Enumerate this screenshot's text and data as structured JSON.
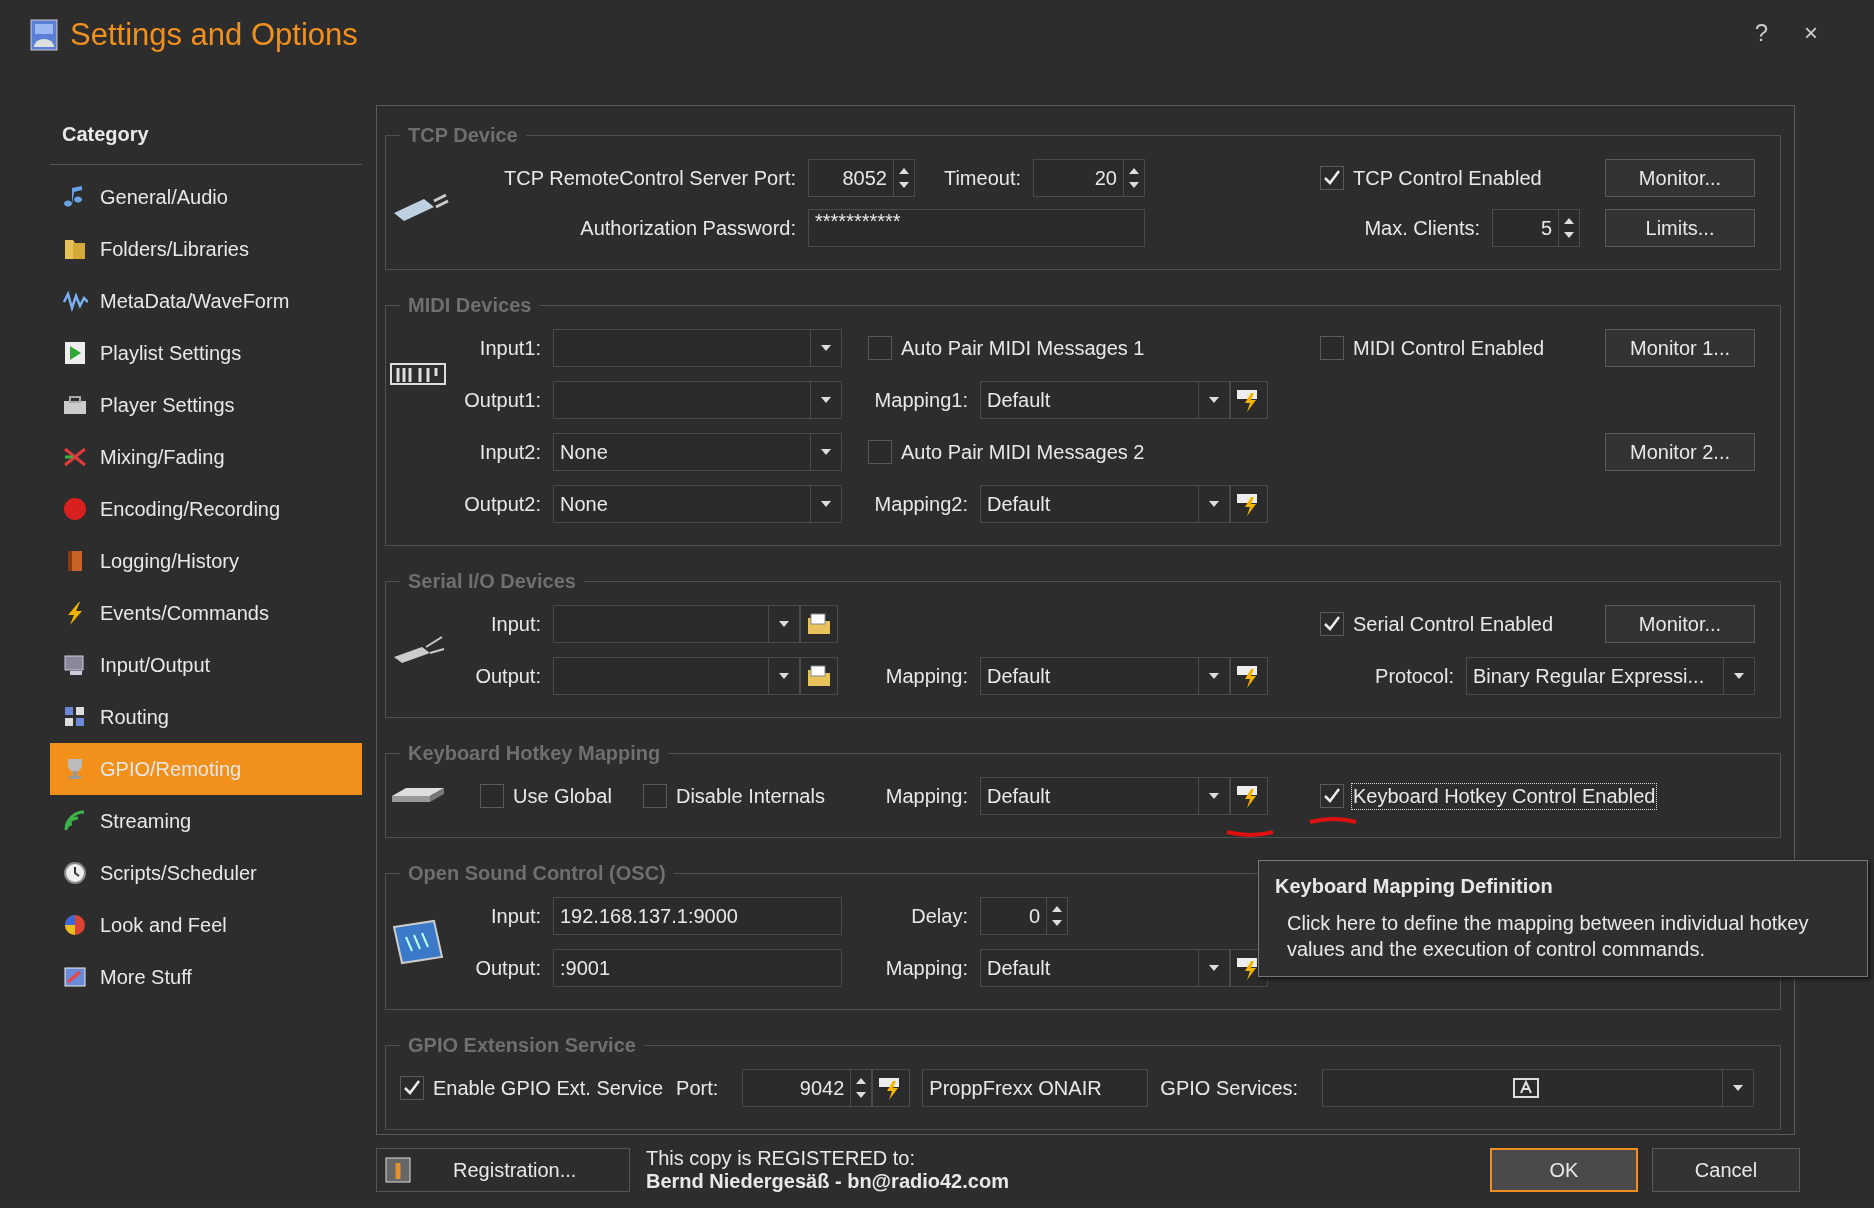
{
  "window": {
    "title": "Settings and Options",
    "help": "?",
    "close": "×"
  },
  "sidebar": {
    "heading": "Category",
    "items": [
      {
        "label": "General/Audio",
        "selected": false
      },
      {
        "label": "Folders/Libraries",
        "selected": false
      },
      {
        "label": "MetaData/WaveForm",
        "selected": false
      },
      {
        "label": "Playlist Settings",
        "selected": false
      },
      {
        "label": "Player Settings",
        "selected": false
      },
      {
        "label": "Mixing/Fading",
        "selected": false
      },
      {
        "label": "Encoding/Recording",
        "selected": false
      },
      {
        "label": "Logging/History",
        "selected": false
      },
      {
        "label": "Events/Commands",
        "selected": false
      },
      {
        "label": "Input/Output",
        "selected": false
      },
      {
        "label": "Routing",
        "selected": false
      },
      {
        "label": "GPIO/Remoting",
        "selected": true
      },
      {
        "label": "Streaming",
        "selected": false
      },
      {
        "label": "Scripts/Scheduler",
        "selected": false
      },
      {
        "label": "Look and Feel",
        "selected": false
      },
      {
        "label": "More Stuff",
        "selected": false
      }
    ]
  },
  "tcp": {
    "legend": "TCP Device",
    "port_label": "TCP RemoteControl Server Port:",
    "port": "8052",
    "timeout_label": "Timeout:",
    "timeout": "20",
    "enabled": {
      "label": "TCP Control Enabled",
      "checked": true
    },
    "monitor": "Monitor...",
    "password_label": "Authorization Password:",
    "password": "***********",
    "max_clients_label": "Max. Clients:",
    "max_clients": "5",
    "limits": "Limits..."
  },
  "midi": {
    "legend": "MIDI Devices",
    "input1": {
      "label": "Input1:"
    },
    "auto_pair1": {
      "label": "Auto Pair MIDI Messages 1",
      "checked": false
    },
    "enabled": {
      "label": "MIDI Control Enabled",
      "checked": false
    },
    "monitor1": "Monitor 1...",
    "output1": {
      "label": "Output1:"
    },
    "mapping1": {
      "label": "Mapping1:",
      "value": "Default"
    },
    "input2": {
      "label": "Input2:",
      "value": "None"
    },
    "auto_pair2": {
      "label": "Auto Pair MIDI Messages 2",
      "checked": false
    },
    "monitor2": "Monitor 2...",
    "output2": {
      "label": "Output2:",
      "value": "None"
    },
    "mapping2": {
      "label": "Mapping2:",
      "value": "Default"
    }
  },
  "serial": {
    "legend": "Serial I/O Devices",
    "input": {
      "label": "Input:"
    },
    "enabled": {
      "label": "Serial Control Enabled",
      "checked": true
    },
    "monitor": "Monitor...",
    "output": {
      "label": "Output:"
    },
    "mapping": {
      "label": "Mapping:",
      "value": "Default"
    },
    "protocol": {
      "label": "Protocol:",
      "value": "Binary Regular Expressi..."
    }
  },
  "keyboard": {
    "legend": "Keyboard Hotkey Mapping",
    "use_global": {
      "label": "Use Global",
      "checked": false
    },
    "disable_internals": {
      "label": "Disable Internals",
      "checked": false
    },
    "mapping": {
      "label": "Mapping:",
      "value": "Default"
    },
    "enabled": {
      "label": "Keyboard Hotkey Control Enabled",
      "checked": true,
      "focused": true
    }
  },
  "osc": {
    "legend": "Open Sound Control (OSC)",
    "input": {
      "label": "Input:",
      "value": "192.168.137.1:9000"
    },
    "delay": {
      "label": "Delay:",
      "value": "0"
    },
    "output": {
      "label": "Output:",
      "value": ":9001"
    },
    "mapping": {
      "label": "Mapping:",
      "value": "Default"
    }
  },
  "gpio": {
    "legend": "GPIO Extension Service",
    "enable": {
      "label": "Enable GPIO Ext. Service",
      "checked": true
    },
    "port": {
      "label": "Port:",
      "value": "9042"
    },
    "service_name": "ProppFrexx ONAIR",
    "services": {
      "label": "GPIO Services:"
    }
  },
  "tooltip": {
    "title": "Keyboard Mapping Definition",
    "text": "Click here to define the mapping between individual hotkey values and the execution of control commands."
  },
  "footer": {
    "registration": "Registration...",
    "registered_label": "This copy is REGISTERED to:",
    "registered_to": "Bernd Niedergesäß - bn@radio42.com",
    "ok": {
      "label": "OK",
      "default": true
    },
    "cancel": "Cancel"
  }
}
